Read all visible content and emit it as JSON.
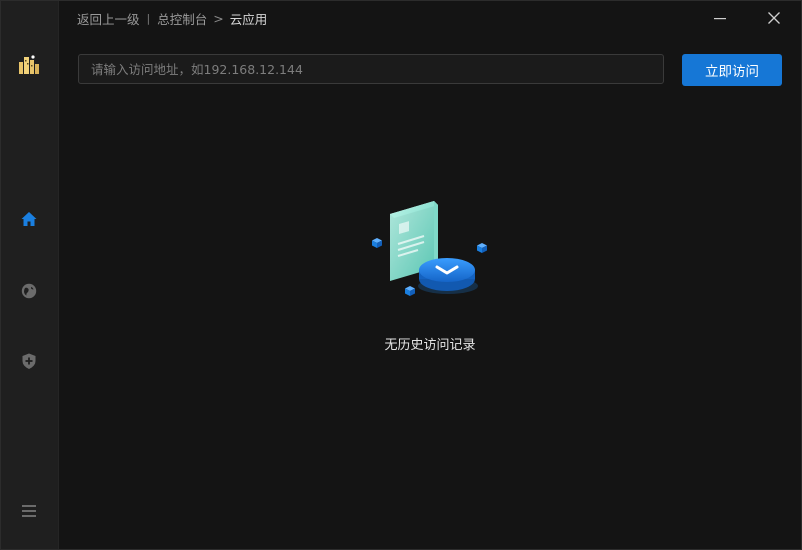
{
  "breadcrumb": {
    "back_label": "返回上一级",
    "separator": "|",
    "parent_label": "总控制台",
    "arrow": ">",
    "current_label": "云应用"
  },
  "window_controls": {
    "minimize_icon": "minimize-icon",
    "close_icon": "close-icon"
  },
  "search": {
    "placeholder": "请输入访问地址，如192.168.12.144",
    "value": ""
  },
  "visit_button": {
    "label": "立即访问"
  },
  "empty_state": {
    "message": "无历史访问记录",
    "illustration": "empty-history-illustration"
  },
  "sidebar": {
    "items": [
      {
        "icon": "app-logo-icon",
        "active": false
      },
      {
        "icon": "home-icon",
        "active": true
      },
      {
        "icon": "globe-icon",
        "active": false
      },
      {
        "icon": "shield-plus-icon",
        "active": false
      },
      {
        "icon": "menu-icon",
        "active": false
      }
    ]
  },
  "colors": {
    "accent": "#1677d6",
    "background": "#141414",
    "sidebar": "#1f1f1f",
    "active_icon": "#1a7fe0",
    "inactive_icon": "#6b6b6b"
  }
}
